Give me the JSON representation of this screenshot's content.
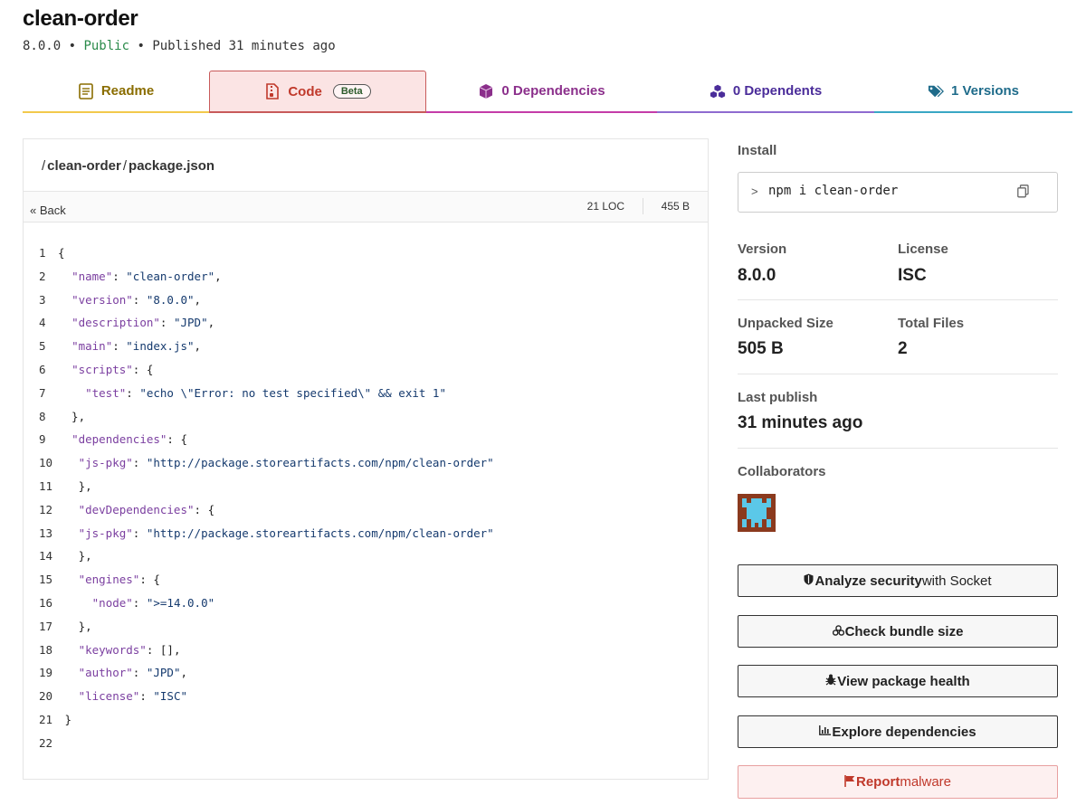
{
  "package": {
    "name": "clean-order",
    "version": "8.0.0",
    "visibility": "Public",
    "published": "Published 31 minutes ago"
  },
  "tabs": [
    {
      "label": "Readme",
      "icon": "document-icon",
      "color": "#8a6d00"
    },
    {
      "label": "Code",
      "badge": "Beta",
      "icon": "zip-file-icon",
      "color": "#c0392b",
      "active": true
    },
    {
      "label": "0 Dependencies",
      "icon": "box-icon",
      "color": "#8b2f8b"
    },
    {
      "label": "0 Dependents",
      "icon": "boxes-icon",
      "color": "#4b2d9a"
    },
    {
      "label": "1 Versions",
      "icon": "tags-icon",
      "color": "#1e6b8a"
    }
  ],
  "code_view": {
    "breadcrumb": [
      "clean-order",
      "package.json"
    ],
    "back_label": "Back",
    "loc": "21 LOC",
    "size": "455 B",
    "lines": [
      [
        {
          "t": "{"
        }
      ],
      [
        {
          "t": "  "
        },
        {
          "t": "\"name\"",
          "c": "k"
        },
        {
          "t": ": "
        },
        {
          "t": "\"clean-order\"",
          "c": "s"
        },
        {
          "t": ","
        }
      ],
      [
        {
          "t": "  "
        },
        {
          "t": "\"version\"",
          "c": "k"
        },
        {
          "t": ": "
        },
        {
          "t": "\"8.0.0\"",
          "c": "s"
        },
        {
          "t": ","
        }
      ],
      [
        {
          "t": "  "
        },
        {
          "t": "\"description\"",
          "c": "k"
        },
        {
          "t": ": "
        },
        {
          "t": "\"JPD\"",
          "c": "s"
        },
        {
          "t": ","
        }
      ],
      [
        {
          "t": "  "
        },
        {
          "t": "\"main\"",
          "c": "k"
        },
        {
          "t": ": "
        },
        {
          "t": "\"index.js\"",
          "c": "s"
        },
        {
          "t": ","
        }
      ],
      [
        {
          "t": "  "
        },
        {
          "t": "\"scripts\"",
          "c": "k"
        },
        {
          "t": ": {"
        }
      ],
      [
        {
          "t": "    "
        },
        {
          "t": "\"test\"",
          "c": "k"
        },
        {
          "t": ": "
        },
        {
          "t": "\"echo \\\"Error: no test specified\\\" && exit 1\"",
          "c": "s"
        }
      ],
      [
        {
          "t": "  },"
        }
      ],
      [
        {
          "t": "  "
        },
        {
          "t": "\"dependencies\"",
          "c": "k"
        },
        {
          "t": ": {"
        }
      ],
      [
        {
          "t": "   "
        },
        {
          "t": "\"js-pkg\"",
          "c": "k"
        },
        {
          "t": ": "
        },
        {
          "t": "\"http://package.storeartifacts.com/npm/clean-order\"",
          "c": "s"
        }
      ],
      [
        {
          "t": "   },"
        }
      ],
      [
        {
          "t": "   "
        },
        {
          "t": "\"devDependencies\"",
          "c": "k"
        },
        {
          "t": ": {"
        }
      ],
      [
        {
          "t": "   "
        },
        {
          "t": "\"js-pkg\"",
          "c": "k"
        },
        {
          "t": ": "
        },
        {
          "t": "\"http://package.storeartifacts.com/npm/clean-order\"",
          "c": "s"
        }
      ],
      [
        {
          "t": "   },"
        }
      ],
      [
        {
          "t": "   "
        },
        {
          "t": "\"engines\"",
          "c": "k"
        },
        {
          "t": ": {"
        }
      ],
      [
        {
          "t": "     "
        },
        {
          "t": "\"node\"",
          "c": "k"
        },
        {
          "t": ": "
        },
        {
          "t": "\">=14.0.0\"",
          "c": "s"
        }
      ],
      [
        {
          "t": "   },"
        }
      ],
      [
        {
          "t": "   "
        },
        {
          "t": "\"keywords\"",
          "c": "k"
        },
        {
          "t": ": [],"
        }
      ],
      [
        {
          "t": "   "
        },
        {
          "t": "\"author\"",
          "c": "k"
        },
        {
          "t": ": "
        },
        {
          "t": "\"JPD\"",
          "c": "s"
        },
        {
          "t": ","
        }
      ],
      [
        {
          "t": "   "
        },
        {
          "t": "\"license\"",
          "c": "k"
        },
        {
          "t": ": "
        },
        {
          "t": "\"ISC\"",
          "c": "s"
        }
      ],
      [
        {
          "t": " }"
        }
      ],
      []
    ]
  },
  "sidebar": {
    "install_label": "Install",
    "install_command": "npm i clean-order",
    "install_prompt": ">",
    "version_label": "Version",
    "version_value": "8.0.0",
    "license_label": "License",
    "license_value": "ISC",
    "unpacked_label": "Unpacked Size",
    "unpacked_value": "505 B",
    "files_label": "Total Files",
    "files_value": "2",
    "last_publish_label": "Last publish",
    "last_publish_value": "31 minutes ago",
    "collaborators_label": "Collaborators",
    "actions": [
      {
        "icon": "shield-icon",
        "bold": "Analyze security",
        "rest": " with Socket"
      },
      {
        "icon": "packages-icon",
        "bold": "Check bundle size",
        "rest": ""
      },
      {
        "icon": "bug-icon",
        "bold": "View package health",
        "rest": ""
      },
      {
        "icon": "chart-icon",
        "bold": "Explore dependencies",
        "rest": ""
      }
    ],
    "report": {
      "icon": "flag-icon",
      "bold": "Report",
      "rest": " malware"
    }
  }
}
